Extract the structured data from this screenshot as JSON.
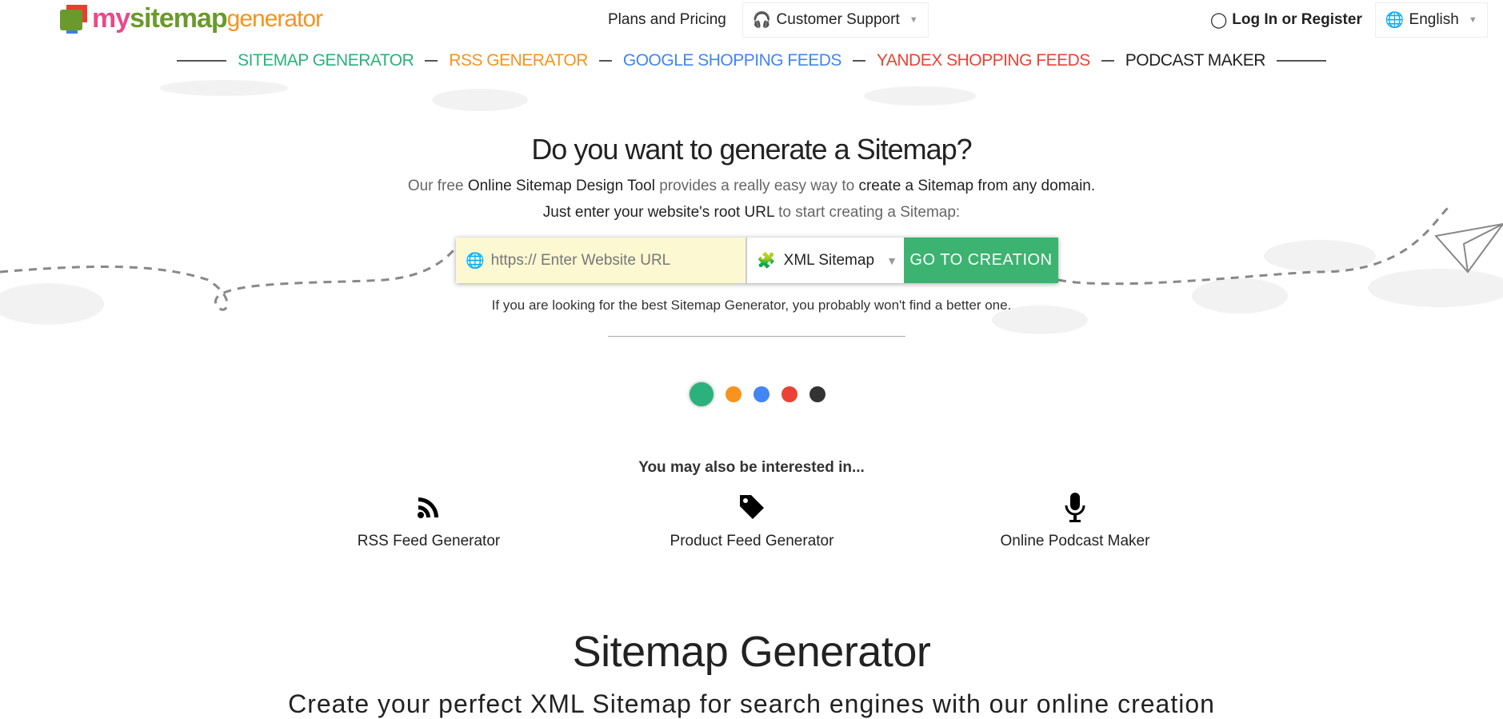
{
  "logo": {
    "my": "my",
    "sitemap": "sitemap",
    "generator": "generator"
  },
  "header": {
    "plans": "Plans and Pricing",
    "support": "Customer Support",
    "login": "Log In or Register",
    "language": "English"
  },
  "nav": [
    {
      "label": "SITEMAP GENERATOR",
      "color": "#2bb27c"
    },
    {
      "label": "RSS GENERATOR",
      "color": "#f7931e"
    },
    {
      "label": "GOOGLE SHOPPING FEEDS",
      "color": "#4285f4"
    },
    {
      "label": "YANDEX SHOPPING FEEDS",
      "color": "#ea4335"
    },
    {
      "label": "PODCAST MAKER",
      "color": "#222222"
    }
  ],
  "hero": {
    "title": "Do you want to generate a Sitemap?",
    "line1": {
      "a": "Our free ",
      "b": "Online Sitemap Design Tool",
      "c": " provides a really easy way to ",
      "d": "create a Sitemap from any domain."
    },
    "line2": {
      "a": "Just enter your website's root URL",
      "b": " to start creating a Sitemap:"
    },
    "url_placeholder": "https:// Enter Website URL",
    "select_value": "XML Sitemap",
    "go_button": "GO TO CREATION",
    "note": "If you are looking for the best Sitemap Generator, you probably won't find a better one."
  },
  "carousel": {
    "colors": [
      "#2bb27c",
      "#f7931e",
      "#4285f4",
      "#ea4335",
      "#333333"
    ],
    "active": 0
  },
  "interest": {
    "title": "You may also be interested in...",
    "items": [
      {
        "label": "RSS Feed Generator",
        "icon": "rss-icon"
      },
      {
        "label": "Product Feed Generator",
        "icon": "tag-icon"
      },
      {
        "label": "Online Podcast Maker",
        "icon": "microphone-icon"
      }
    ]
  },
  "section": {
    "title": "Sitemap Generator",
    "subtitle": "Create your perfect XML Sitemap for search engines with our online creation"
  }
}
